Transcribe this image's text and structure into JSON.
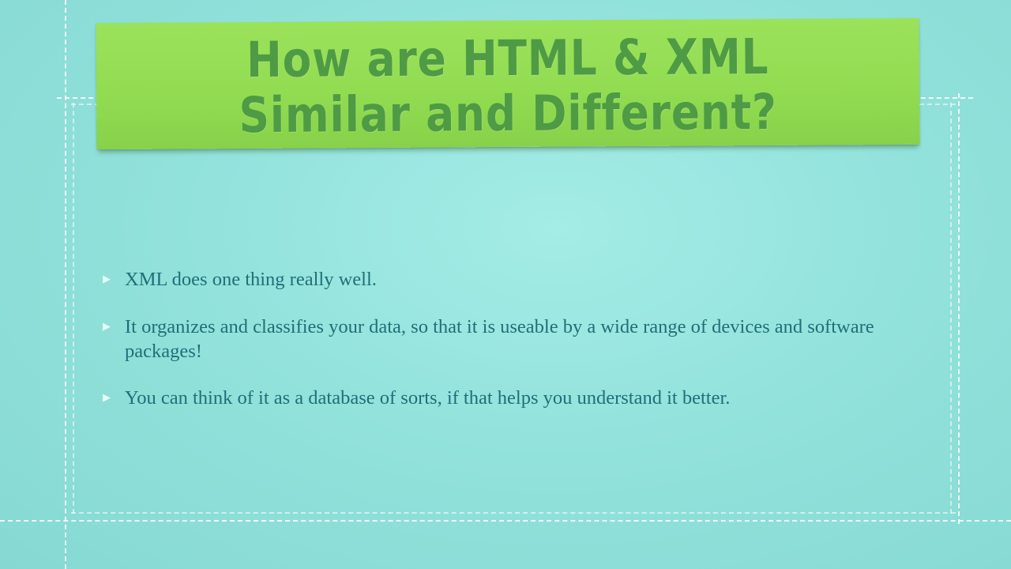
{
  "slide": {
    "title": "How are HTML & XML Similar and Different?",
    "bullets": [
      {
        "marker": "▶",
        "text": "XML does one thing really well."
      },
      {
        "marker": "▶",
        "text": "It organizes and classifies your data, so that it is useable by a wide range of devices and software packages!"
      },
      {
        "marker": "▶",
        "text": "You can think of it as a database of sorts, if that helps you understand it better."
      }
    ]
  },
  "colors": {
    "background": "#93e2dc",
    "title_note": "#92dc52",
    "title_text": "#4f9a45",
    "body_text": "#1f6f78",
    "stitching": "#ffffff"
  }
}
